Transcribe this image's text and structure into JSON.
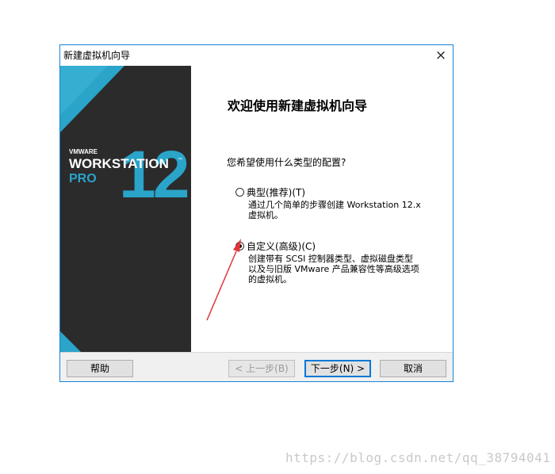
{
  "window": {
    "title": "新建虚拟机向导",
    "close_icon": "×"
  },
  "banner": {
    "brand_small": "VMWARE",
    "product_name": "WORKSTATION",
    "edition": "PRO",
    "version": "12",
    "trademark": "™",
    "colors": {
      "background": "#2b2b2b",
      "accent": "#2aa4c9"
    }
  },
  "content": {
    "heading": "欢迎使用新建虚拟机向导",
    "question": "您希望使用什么类型的配置?",
    "options": [
      {
        "label": "典型(推荐)(T)",
        "description_lines": [
          "通过几个简单的步骤创建 Workstation 12.x",
          "虚拟机。"
        ],
        "selected": false
      },
      {
        "label": "自定义(高级)(C)",
        "description_lines": [
          "创建带有 SCSI 控制器类型、虚拟磁盘类型",
          "以及与旧版 VMware 产品兼容性等高级选项",
          "的虚拟机。"
        ],
        "selected": true
      }
    ]
  },
  "footer": {
    "help": "帮助",
    "back": "< 上一步(B)",
    "next": "下一步(N) >",
    "cancel": "取消"
  },
  "watermark": "https://blog.csdn.net/qq_38794041",
  "colors": {
    "dialog_border": "#1883d7",
    "footer_bg": "#f0f0f0",
    "annotation_arrow": "#e0343a"
  }
}
